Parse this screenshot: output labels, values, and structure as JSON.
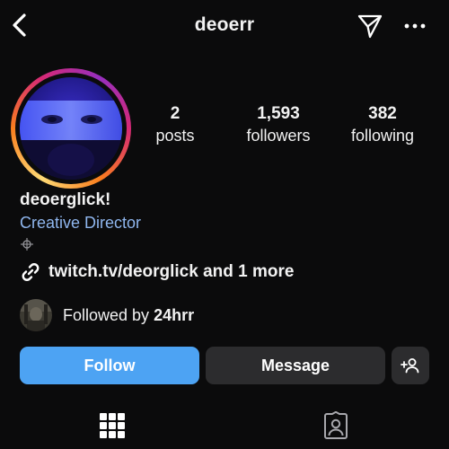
{
  "header": {
    "username": "deoerr",
    "back_icon": "chevron-left-icon",
    "send_icon": "paper-plane-icon",
    "more_icon": "more-horizontal-icon"
  },
  "profile": {
    "avatar_ring_colors": [
      "#feda75",
      "#fa7e1e",
      "#d62976",
      "#962fbf"
    ],
    "stats": {
      "posts_count": "2",
      "posts_label": "posts",
      "followers_count": "1,593",
      "followers_label": "followers",
      "following_count": "382",
      "following_label": "following"
    },
    "display_name": "deoerglick!",
    "category": "Creative Director",
    "threads_icon": "threads-icon",
    "link_icon": "link-icon",
    "link_text": "twitch.tv/deorglick and 1 more",
    "followed_by_prefix": "Followed by ",
    "followed_by_user": "24hrr"
  },
  "actions": {
    "follow_label": "Follow",
    "message_label": "Message",
    "suggest_icon": "add-person-icon"
  },
  "tabs": {
    "grid_icon": "grid-icon",
    "tagged_icon": "tagged-person-icon"
  },
  "colors": {
    "background": "#0b0b0c",
    "follow_button": "#4da3f3",
    "secondary_button": "#2c2c2e",
    "category_text": "#8fb6ee"
  }
}
